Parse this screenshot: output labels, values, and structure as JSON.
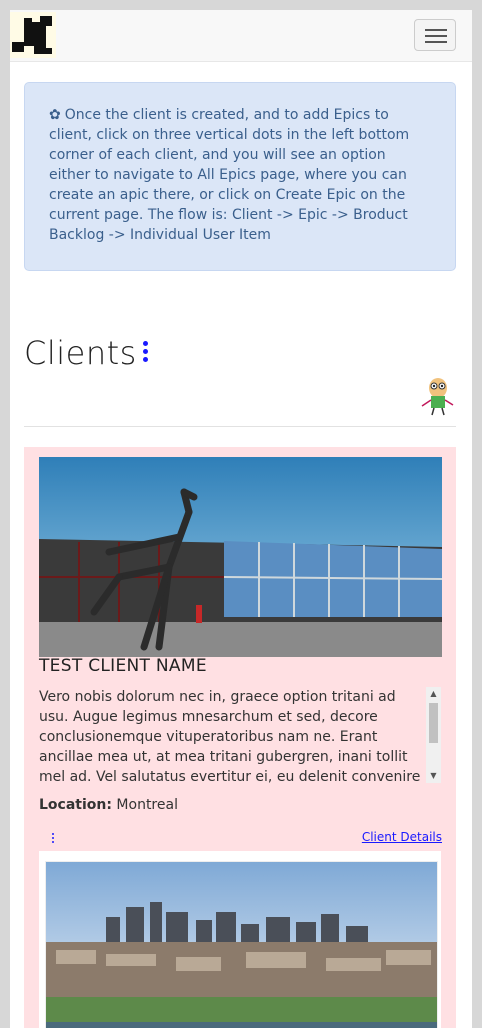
{
  "info": {
    "gear_icon": "gear-icon",
    "text": "Once the client is created, and to add Epics to client, click on three vertical dots in the left bottom corner of each client, and you will see an option either to navigate to All Epics page, where you can create an apic there, or click on Create Epic on the current page. The flow is: Client -> Epic -> Broduct Backlog -> Individual User Item"
  },
  "heading": {
    "title": "Clients"
  },
  "client": {
    "name": "TEST CLIENT NAME",
    "description": "Vero nobis dolorum nec in, graece option tritani ad usu. Augue legimus mnesarchum et sed, decore conclusionemque vituperatoribus nam ne. Erant ancillae mea ut, at mea tritani gubergren, inani tollit mel ad. Vel salutatus evertitur ei, eu delenit convenire",
    "location_label": "Location:",
    "location": "Montreal",
    "details_link": "Client Details"
  },
  "colors": {
    "accent_link": "#1a1aff",
    "info_bg": "#dbe6f7",
    "card_bg": "#ffe0e3"
  }
}
